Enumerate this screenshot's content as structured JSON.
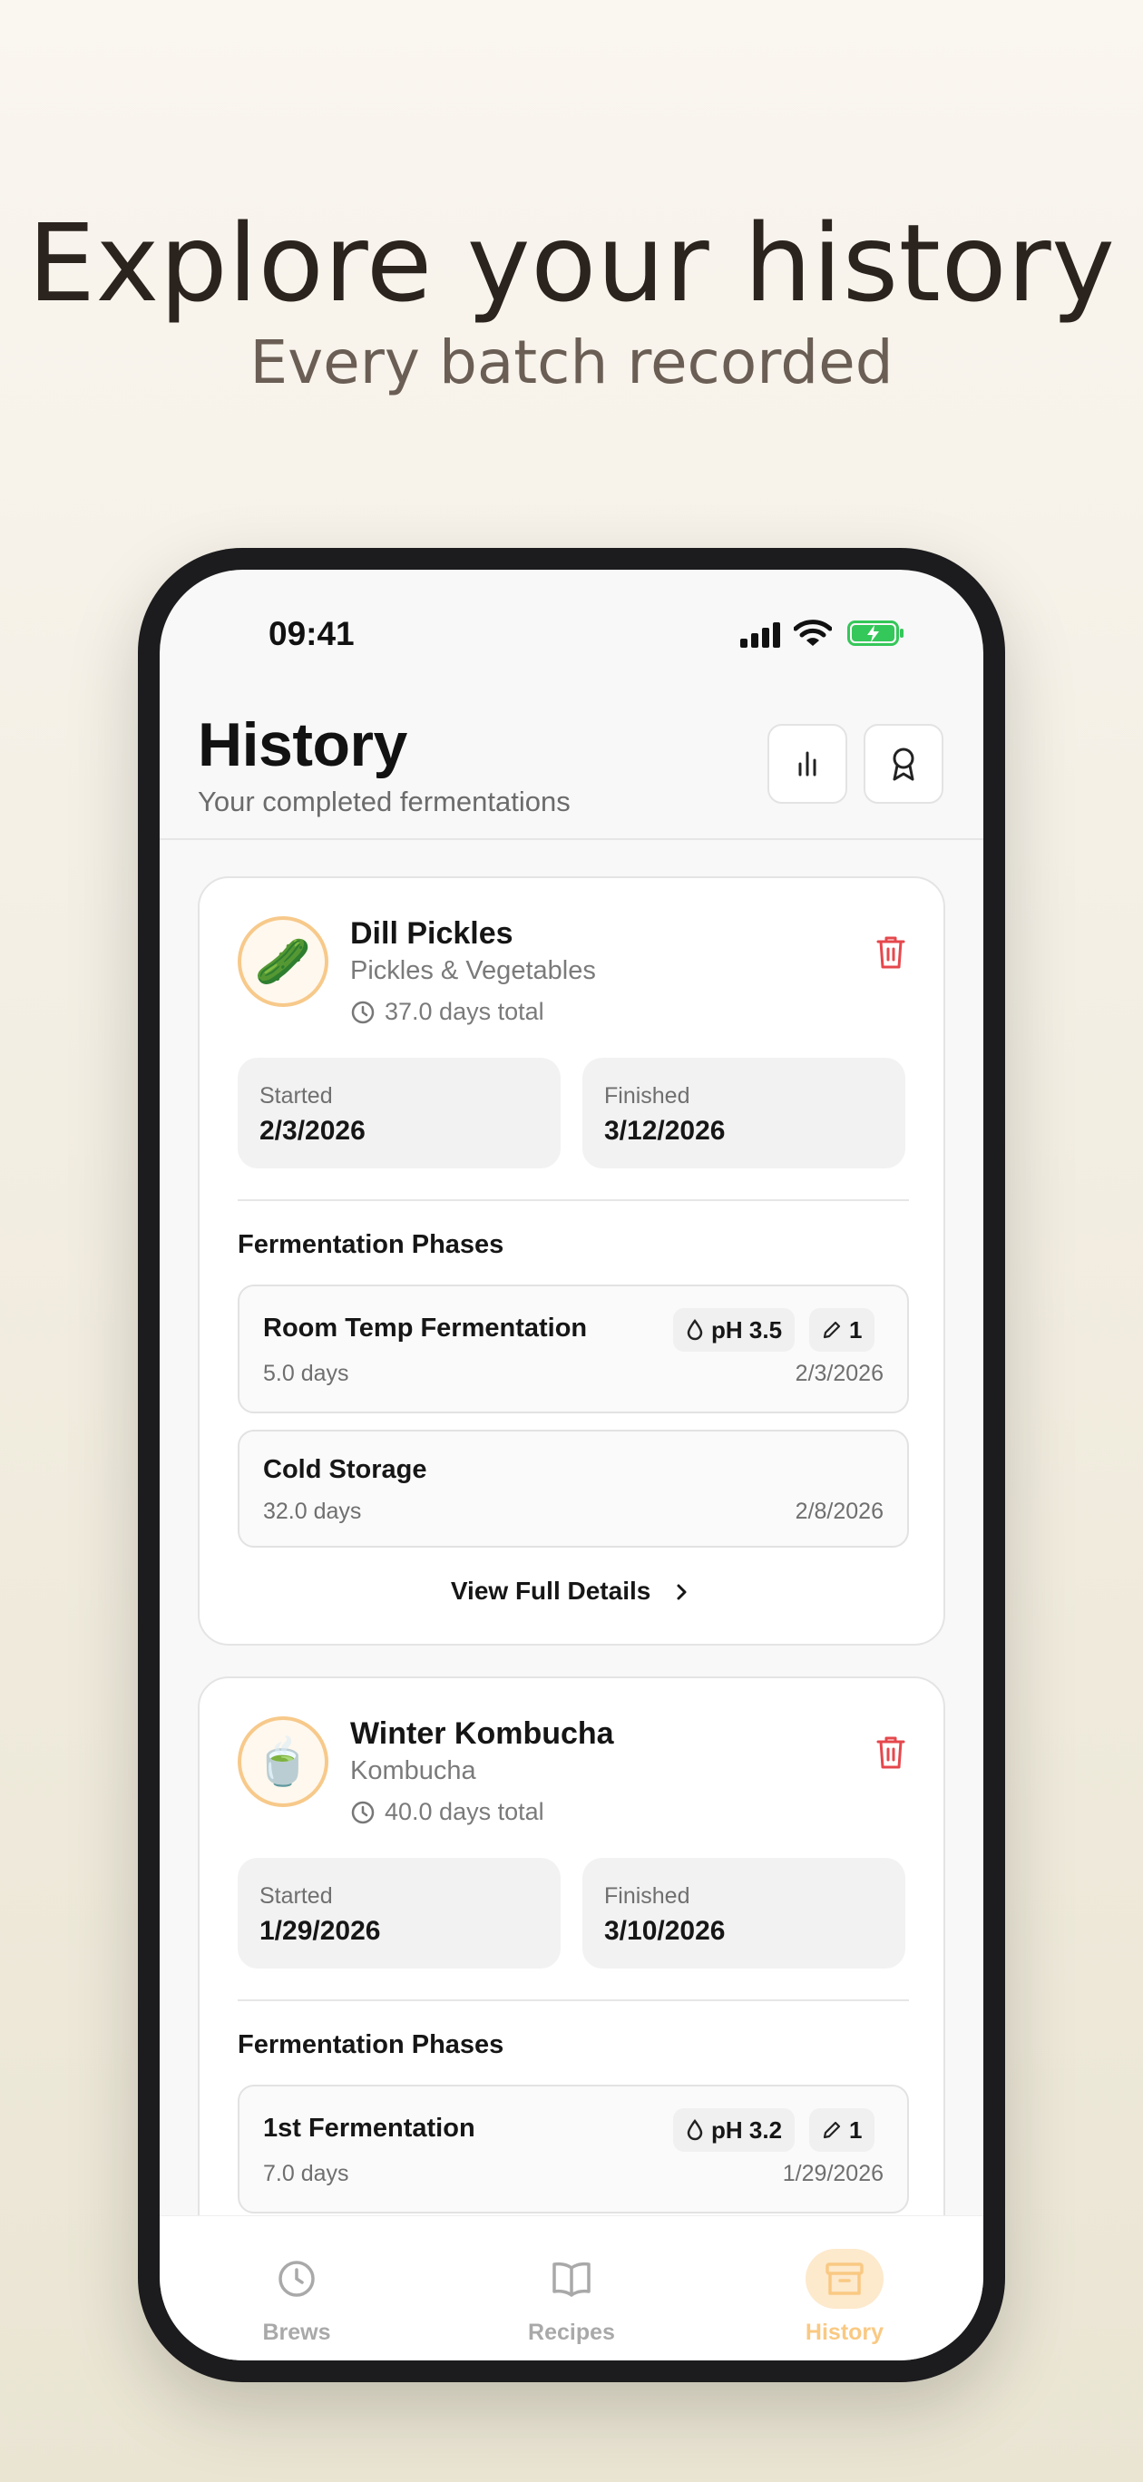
{
  "marketing": {
    "headline": "Explore your history",
    "subhead": "Every batch recorded"
  },
  "status_bar": {
    "time": "09:41"
  },
  "header": {
    "title": "History",
    "subtitle": "Your completed fermentations",
    "buttons": [
      {
        "icon": "bar-chart-icon"
      },
      {
        "icon": "award-ribbon-icon"
      }
    ]
  },
  "batches": [
    {
      "emoji": "🥒",
      "name": "Dill Pickles",
      "category": "Pickles & Vegetables",
      "duration": "37.0 days total",
      "started_label": "Started",
      "started": "2/3/2026",
      "finished_label": "Finished",
      "finished": "3/12/2026",
      "phases_title": "Fermentation Phases",
      "phases": [
        {
          "name": "Room Temp Fermentation",
          "days": "5.0 days",
          "date": "2/3/2026",
          "ph": "pH 3.5",
          "notes": "1"
        },
        {
          "name": "Cold Storage",
          "days": "32.0 days",
          "date": "2/8/2026"
        }
      ],
      "view_details": "View Full Details"
    },
    {
      "emoji": "🍵",
      "name": "Winter Kombucha",
      "category": "Kombucha",
      "duration": "40.0 days total",
      "started_label": "Started",
      "started": "1/29/2026",
      "finished_label": "Finished",
      "finished": "3/10/2026",
      "phases_title": "Fermentation Phases",
      "phases": [
        {
          "name": "1st Fermentation",
          "days": "7.0 days",
          "date": "1/29/2026",
          "ph": "pH 3.2",
          "notes": "1"
        }
      ]
    }
  ],
  "tabs": [
    {
      "label": "Brews",
      "icon": "clock-icon",
      "active": false
    },
    {
      "label": "Recipes",
      "icon": "book-icon",
      "active": false
    },
    {
      "label": "History",
      "icon": "archive-icon",
      "active": true
    }
  ],
  "colors": {
    "accent": "#F9C983",
    "danger": "#E5484D"
  }
}
